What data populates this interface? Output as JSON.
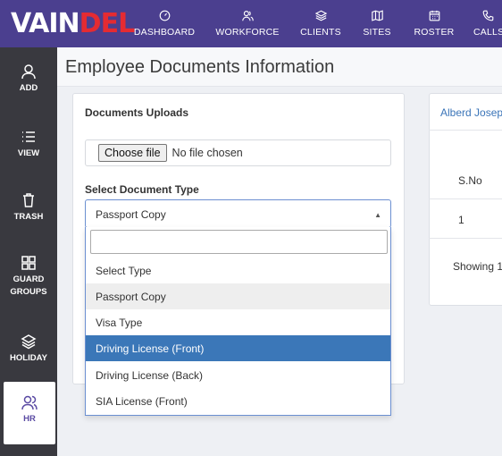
{
  "brand": {
    "part1": "VAIN",
    "part2": "DEL"
  },
  "topnav": [
    {
      "label": "DASHBOARD",
      "icon": "gauge-icon"
    },
    {
      "label": "WORKFORCE",
      "icon": "users-icon"
    },
    {
      "label": "CLIENTS",
      "icon": "layers-icon"
    },
    {
      "label": "SITES",
      "icon": "map-icon"
    },
    {
      "label": "ROSTER",
      "icon": "calendar-icon"
    },
    {
      "label": "CALLS",
      "icon": "phone-icon"
    }
  ],
  "sidebar": [
    {
      "label": "ADD",
      "icon": "user-add-icon"
    },
    {
      "label": "VIEW",
      "icon": "list-icon"
    },
    {
      "label": "TRASH",
      "icon": "trash-icon"
    },
    {
      "label": "GUARD GROUPS",
      "icon": "grid-icon"
    },
    {
      "label": "HOLIDAY",
      "icon": "layers-icon"
    },
    {
      "label": "HR",
      "icon": "users-icon",
      "active": true
    }
  ],
  "page": {
    "title": "Employee Documents Information"
  },
  "form": {
    "uploads_label": "Documents Uploads",
    "file_button": "Choose file",
    "file_status": "No file chosen",
    "doc_type_label": "Select Document Type",
    "doc_type_value": "Passport Copy",
    "options": [
      "Select Type",
      "Passport Copy",
      "Visa Type",
      "Driving License (Front)",
      "Driving License (Back)",
      "SIA License (Front)"
    ]
  },
  "right_panel": {
    "employee_name": "Alberd Josep",
    "col_sno": "S.No",
    "row1_sno": "1",
    "footer": "Showing 1"
  },
  "colors": {
    "nav_bg": "#4b3f8f",
    "sidebar_bg": "#39393f",
    "brand_red": "#e52b32",
    "highlight": "#3b77b8"
  }
}
